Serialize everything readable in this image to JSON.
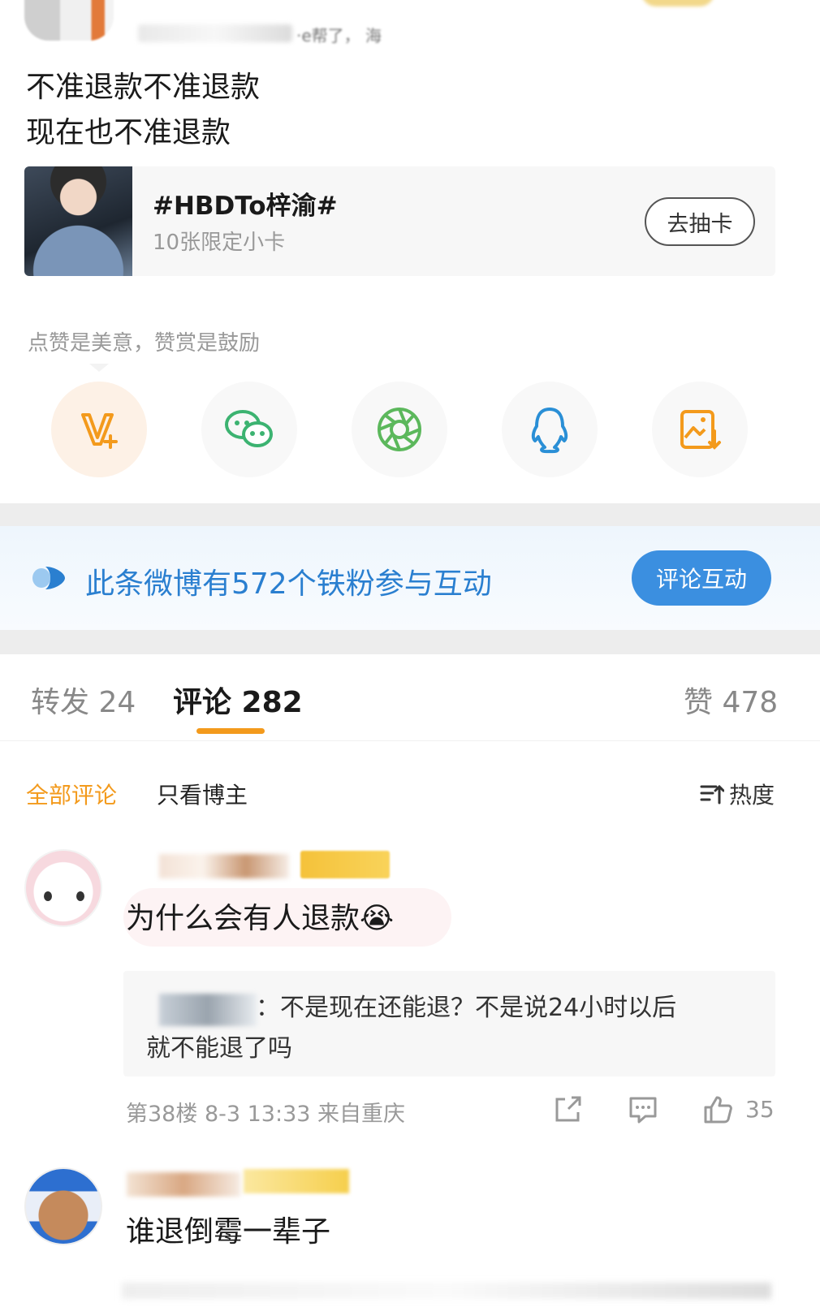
{
  "post": {
    "author_meta": "·e帮了，  海",
    "lines": [
      "不准退款不准退款",
      "现在也不准退款"
    ]
  },
  "topic_card": {
    "title": "#HBDTo梓渝#",
    "subtitle": "10张限定小卡",
    "button": "去抽卡"
  },
  "like_hint": "点赞是美意，赞赏是鼓励",
  "share_icons": [
    "v-plus-icon",
    "wechat-icon",
    "moments-icon",
    "qq-icon",
    "save-image-icon"
  ],
  "fans_banner": {
    "text": "此条微博有572个铁粉参与互动",
    "button": "评论互动"
  },
  "tabs": {
    "repost": "转发 24",
    "comments": "评论 282",
    "likes": "赞 478"
  },
  "filters": {
    "all": "全部评论",
    "author_only": "只看博主",
    "sort": "热度"
  },
  "comments": [
    {
      "text": "为什么会有人退款😭",
      "reply_suffix": "：不是现在还能退？不是说24小时以后",
      "reply_line2": "就不能退了吗",
      "meta": "第38楼  8-3 13:33  来自重庆",
      "likes": "35"
    },
    {
      "text": "谁退倒霉一辈子"
    }
  ],
  "colors": {
    "accent_orange": "#f39a1c",
    "link_blue": "#2a7fd0",
    "button_blue": "#3b8fe0"
  }
}
